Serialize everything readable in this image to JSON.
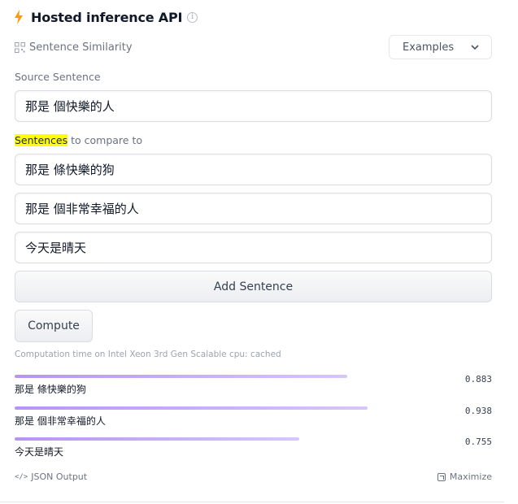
{
  "header": {
    "title": "Hosted inference API",
    "info_icon": "info-icon",
    "bolt_color": "#f59e0b"
  },
  "task": {
    "label": "Sentence Similarity",
    "icon": "grid-icon"
  },
  "examples": {
    "label": "Examples",
    "icon": "chevron-down-icon"
  },
  "source": {
    "label": "Source Sentence",
    "value": "那是 個快樂的人"
  },
  "sentences": {
    "label_highlight": "Sentences",
    "label_rest": " to compare to",
    "items": [
      "那是 條快樂的狗",
      "那是 個非常幸福的人",
      "今天是晴天"
    ]
  },
  "buttons": {
    "add": "Add Sentence",
    "compute": "Compute"
  },
  "computation": {
    "text": "Computation time on Intel Xeon 3rd Gen Scalable cpu: cached"
  },
  "results": [
    {
      "label": "那是 條快樂的狗",
      "score": "0.883",
      "score_value": 0.883
    },
    {
      "label": "那是 個非常幸福的人",
      "score": "0.938",
      "score_value": 0.938
    },
    {
      "label": "今天是晴天",
      "score": "0.755",
      "score_value": 0.755
    }
  ],
  "footer": {
    "json_output": "JSON Output",
    "maximize": "Maximize"
  },
  "colors": {
    "accent_bar": "#b794f4",
    "highlight": "#ffff00"
  }
}
